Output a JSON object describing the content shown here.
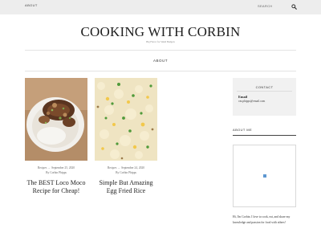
{
  "topbar": {
    "about_label": "ABOUT",
    "search_label": "SEARCH",
    "search_icon": "search-icon"
  },
  "site": {
    "title": "COOKING WITH CORBIN",
    "tagline": "Big Flavor for Small Budgets"
  },
  "nav": {
    "about_label": "ABOUT"
  },
  "posts": [
    {
      "category": "Recipes",
      "date": "September 25, 2020",
      "author_prefix": "By",
      "author": "Corbin Phipps",
      "title_line1": "The BEST Loco Moco",
      "title_line2": "Recipe for Cheap!"
    },
    {
      "category": "Recipes",
      "date": "September 24, 2020",
      "author_prefix": "By",
      "author": "Corbin Phipps",
      "title_line1": "Simple But Amazing",
      "title_line2": "Egg Fried Rice"
    }
  ],
  "sidebar": {
    "contact_heading": "CONTACT",
    "email_label": "Email",
    "email_value": "cm.phipps@email.com",
    "about_heading": "ABOUT ME",
    "about_text": "Hi, I'm Corbin. I love to cook, eat, and share my knowledge and passion for food with others!"
  }
}
